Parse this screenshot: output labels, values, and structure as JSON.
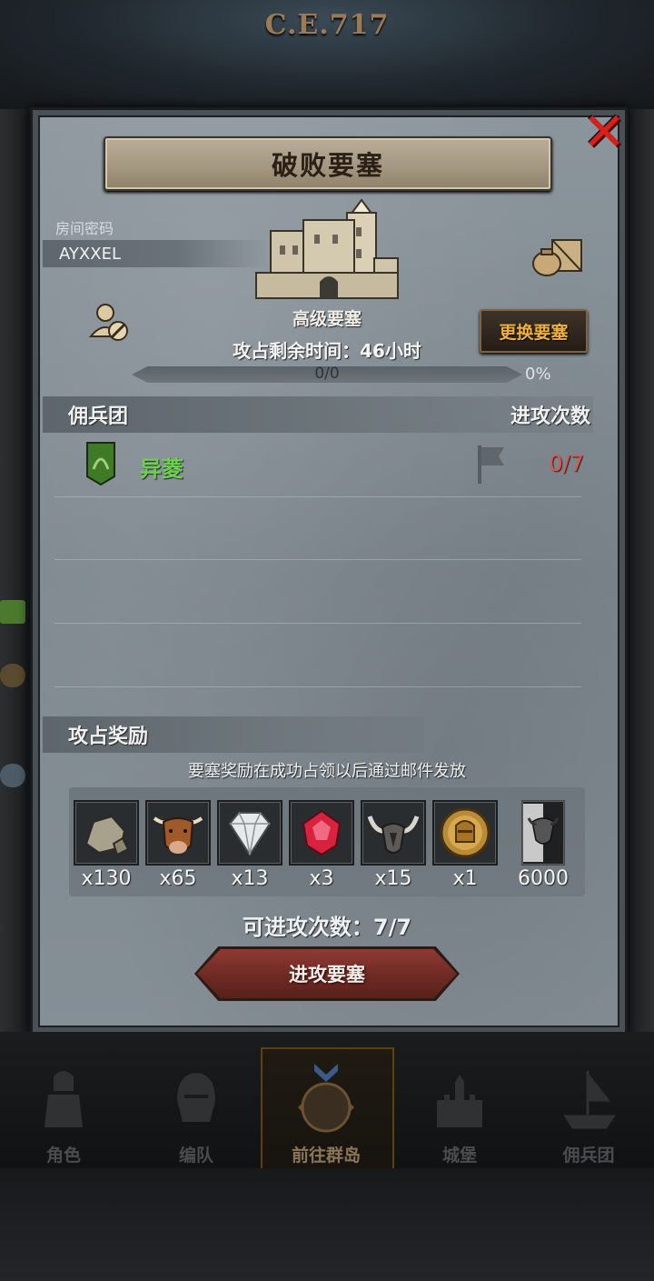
{
  "header": {
    "era": "C.E.717"
  },
  "dialog": {
    "title": "破败要塞",
    "room_code_label": "房间密码",
    "room_code": "AYXXEL",
    "fortress_name": "高级要塞",
    "time_left": "攻占剩余时间：46小时",
    "swap_button": "更换要塞",
    "progress": {
      "text": "0/0",
      "percent": "0%",
      "fraction": 0
    },
    "mercenary_header": "佣兵团",
    "attack_count_header": "进攻次数",
    "mercenaries": [
      {
        "name": "异菱",
        "attacks": "0/7"
      }
    ],
    "rewards_header": "攻占奖励",
    "rewards_note": "要塞奖励在成功占领以后通过邮件发放",
    "rewards": [
      {
        "icon": "stone-icon",
        "qty": "x130"
      },
      {
        "icon": "ox-icon",
        "qty": "x65"
      },
      {
        "icon": "diamond-icon",
        "qty": "x13"
      },
      {
        "icon": "ruby-icon",
        "qty": "x3"
      },
      {
        "icon": "horned-helmet-icon",
        "qty": "x15"
      },
      {
        "icon": "knight-medal-icon",
        "qty": "x1"
      },
      {
        "icon": "bull-banner-icon",
        "qty": "6000"
      }
    ],
    "attempts": "可进攻次数：7/7",
    "attack_button": "进攻要塞"
  },
  "nav": {
    "items": [
      {
        "label": "角色",
        "icon": "knight-icon"
      },
      {
        "label": "编队",
        "icon": "helmet-icon"
      },
      {
        "label": "前往群岛",
        "icon": "compass-icon"
      },
      {
        "label": "城堡",
        "icon": "castle-icon"
      },
      {
        "label": "佣兵团",
        "icon": "ship-icon"
      }
    ],
    "active_index": 2
  },
  "colors": {
    "accent_gold": "#f0b040",
    "merc_green": "#6bd24a",
    "count_red": "#e0564a",
    "close_red": "#d8201a"
  }
}
